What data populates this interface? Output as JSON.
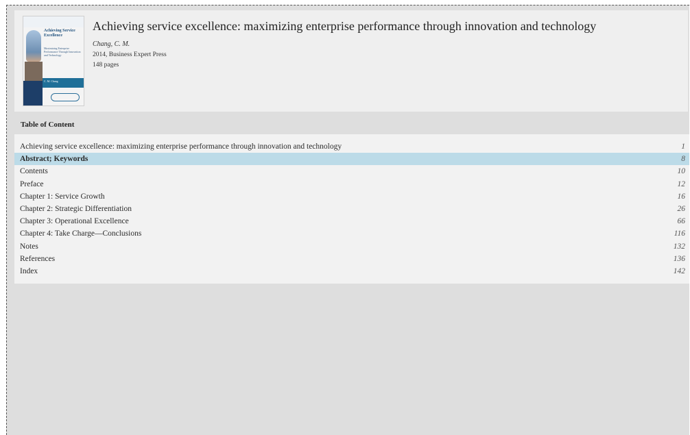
{
  "book": {
    "title": "Achieving service excellence: maximizing enterprise performance through innovation and technology",
    "author": "Chang, C. M.",
    "year_publisher": "2014,  Business Expert Press",
    "pages": "148 pages",
    "cover": {
      "title": "Achieving Service Excellence",
      "subtitle": "Maximizing Enterprise Performance Through Innovation and Technology",
      "author": "C. M. Chang"
    }
  },
  "toc": {
    "heading": "Table of Content",
    "entries": [
      {
        "label": "Achieving service excellence: maximizing enterprise performance through innovation and technology",
        "page": "1"
      },
      {
        "label": "Abstract; Keywords",
        "page": "8",
        "highlighted": true
      },
      {
        "label": "Contents",
        "page": "10"
      },
      {
        "label": "Preface",
        "page": "12"
      },
      {
        "label": "Chapter 1: Service Growth",
        "page": "16"
      },
      {
        "label": "Chapter 2: Strategic Differentiation",
        "page": "26"
      },
      {
        "label": "Chapter 3: Operational Excellence",
        "page": "66"
      },
      {
        "label": "Chapter 4: Take Charge—Conclusions",
        "page": "116"
      },
      {
        "label": "Notes",
        "page": "132"
      },
      {
        "label": "References",
        "page": "136"
      },
      {
        "label": "Index",
        "page": "142"
      }
    ]
  },
  "colors": {
    "background": "#dedede",
    "panel": "#efefef",
    "highlight": "#bcdbe8"
  }
}
